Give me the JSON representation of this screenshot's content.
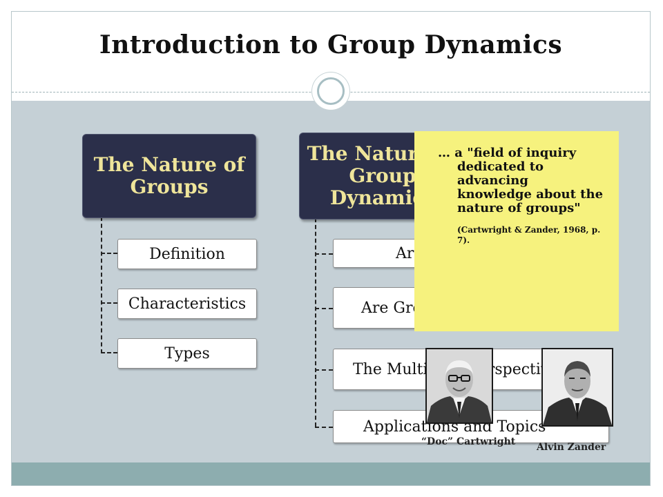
{
  "slide": {
    "title": "Introduction to Group Dynamics"
  },
  "left_branch": {
    "heading": "The Nature of Groups",
    "items": [
      "Definition",
      "Characteristics",
      "Types"
    ]
  },
  "right_branch": {
    "heading": "The Nature of Group Dynamics",
    "items": [
      "Are Groups Real?",
      "Are Groups Worth Studying?",
      "The Multilevel Perspective",
      "Applications and Topics"
    ]
  },
  "quote": {
    "text": "… a \"field of inquiry dedicated to advancing knowledge about the nature of groups\"",
    "citation": "(Cartwright & Zander, 1968, p. 7)."
  },
  "photos": [
    {
      "caption": "“Doc” Cartwright"
    },
    {
      "caption": "Alvin Zander"
    }
  ],
  "colors": {
    "content_band": "#c5d0d6",
    "bottom_band": "#8dadaf",
    "heading_box": "#2b2f4a",
    "heading_text": "#efe59a",
    "quote_bg": "#f6f27e"
  }
}
